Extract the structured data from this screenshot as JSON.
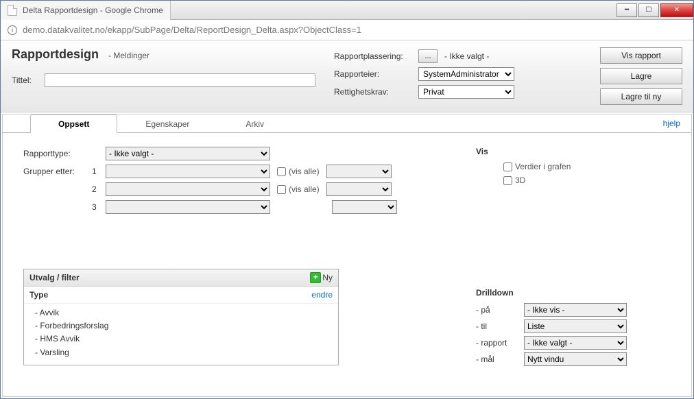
{
  "window": {
    "title": "Delta Rapportdesign - Google Chrome",
    "url": "demo.datakvalitet.no/ekapp/SubPage/Delta/ReportDesign_Delta.aspx?ObjectClass=1"
  },
  "header": {
    "title": "Rapportdesign",
    "subtitle": "- Meldinger",
    "tittel_label": "Tittel:",
    "tittel_value": "",
    "placement_label": "Rapportplassering:",
    "placement_button": "...",
    "placement_value": "- Ikke valgt -",
    "owner_label": "Rapporteier:",
    "owner_value": "SystemAdministrator",
    "rights_label": "Rettighetskrav:",
    "rights_value": "Privat",
    "buttons": {
      "show": "Vis rapport",
      "save": "Lagre",
      "saveas": "Lagre til ny"
    }
  },
  "tabs": [
    "Oppsett",
    "Egenskaper",
    "Arkiv"
  ],
  "active_tab": 0,
  "help_link": "hjelp",
  "oppsett": {
    "type_label": "Rapporttype:",
    "type_value": "- Ikke valgt -",
    "group_label": "Grupper etter:",
    "rows": [
      "1",
      "2",
      "3"
    ],
    "vis_alle": "(vis alle)"
  },
  "vis": {
    "title": "Vis",
    "opt1": "Verdier i grafen",
    "opt2": "3D"
  },
  "filter": {
    "title": "Utvalg / filter",
    "new_label": "Ny",
    "type_label": "Type",
    "edit_label": "endre",
    "items": [
      "- Avvik",
      "- Forbedringsforslag",
      "- HMS Avvik",
      "- Varsling"
    ]
  },
  "drilldown": {
    "title": "Drilldown",
    "rows": [
      {
        "label": "- på",
        "value": "- Ikke vis -"
      },
      {
        "label": "- til",
        "value": "Liste"
      },
      {
        "label": "- rapport",
        "value": "- Ikke valgt -"
      },
      {
        "label": "- mål",
        "value": "Nytt vindu"
      }
    ]
  }
}
